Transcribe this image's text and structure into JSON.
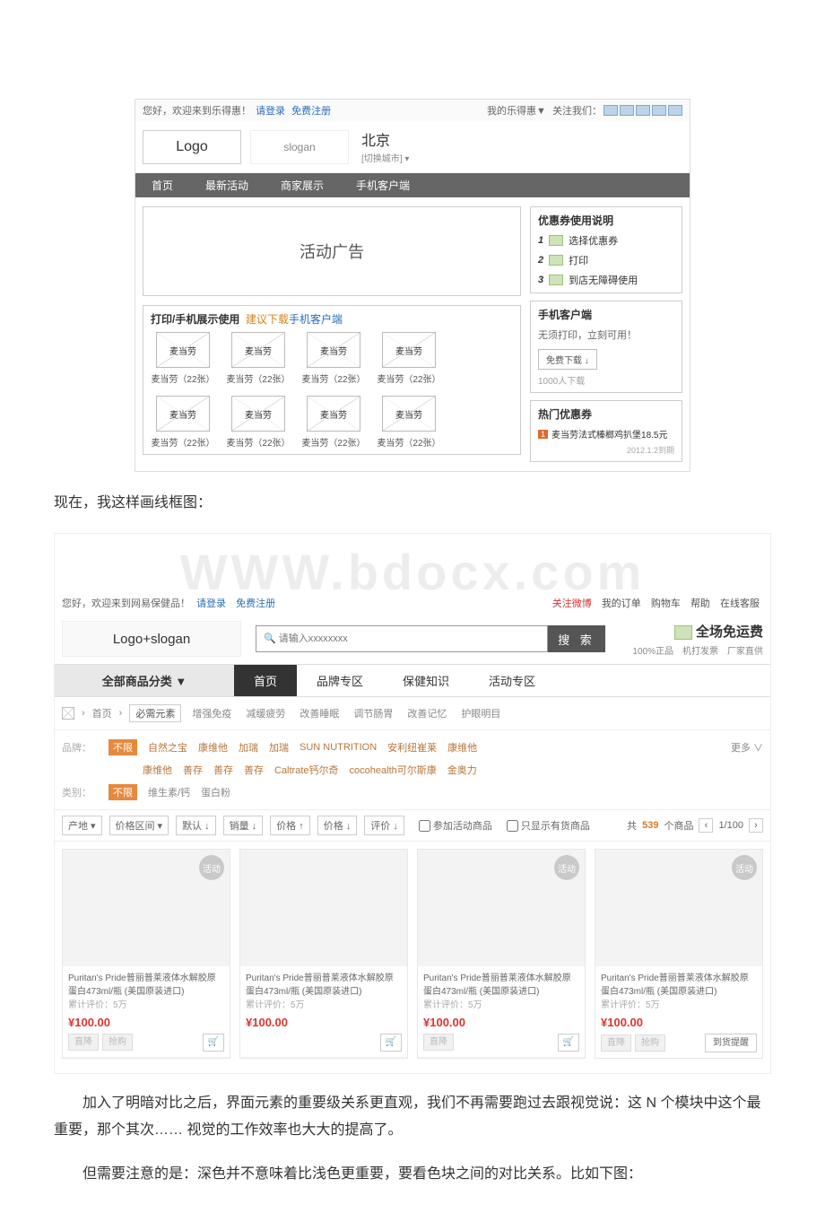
{
  "wf1": {
    "top_greet": "您好，欢迎来到乐得惠！",
    "login": "请登录",
    "register": "免费注册",
    "my": "我的乐得惠▼",
    "follow": "关注我们：",
    "logo": "Logo",
    "slogan": "slogan",
    "city": "北京",
    "city_sub": "[切换城市] ▾",
    "nav": [
      "首页",
      "最新活动",
      "商家展示",
      "手机客户端"
    ],
    "hero": "活动广告",
    "section_title": "打印/手机展示使用",
    "section_tip": "建议下载",
    "section_link": "手机客户端",
    "item_name": "麦当劳",
    "item_count": "麦当劳（22张）",
    "side_inst_title": "优惠券使用说明",
    "steps": [
      "选择优惠券",
      "打印",
      "到店无障碍使用"
    ],
    "side_mob_title": "手机客户端",
    "side_mob_txt": "无须打印，立刻可用！",
    "side_mob_btn": "免费下载 ↓",
    "side_mob_sub": "1000人下载",
    "side_hot_title": "热门优惠券",
    "side_hot_item": "麦当劳法式榛榔鸡扒堡18.5元",
    "side_hot_date": "2012.1.2到期"
  },
  "para1": "现在，我这样画线框图：",
  "wf2": {
    "top_greet": "您好，欢迎来到网易保健品！",
    "login": "请登录",
    "register": "免费注册",
    "rt": [
      "关注微博",
      "我的订单",
      "购物车",
      "帮助",
      "在线客服"
    ],
    "logo": "Logo+slogan",
    "search_ph": "🔍 请输入xxxxxxxx",
    "search_btn": "搜 索",
    "promo_big": "全场免运费",
    "promo_sm": "100%正品　机打发票　厂家直供",
    "cat": "全部商品分类 ▼",
    "nav": [
      "首页",
      "品牌专区",
      "保健知识",
      "活动专区"
    ],
    "crumb_root": "首页",
    "crumb_cur": "必需元素",
    "crumb_items": [
      "增强免疫",
      "减缓疲劳",
      "改善睡眠",
      "调节肠胃",
      "改善记忆",
      "护眼明目"
    ],
    "filter_brand_label": "品牌：",
    "filter_all": "不限",
    "brand_r1": [
      "自然之宝",
      "康维他",
      "加瑞",
      "加瑞",
      "SUN NUTRITION",
      "安利纽崔莱",
      "康维他"
    ],
    "brand_r2": [
      "康维他",
      "善存",
      "善存",
      "善存",
      "Caltrate钙尔奇",
      "cocohealth可尔斯康",
      "金奥力"
    ],
    "filter_more": "更多 ∨",
    "filter_cat_label": "类别：",
    "cat_opts": [
      "维生素/钙",
      "蛋白粉"
    ],
    "sort_origin": "产地",
    "sort_price_range": "价格区间",
    "sort_default": "默认 ↓",
    "sort_sales": "销量 ↓",
    "sort_price_up": "价格 ↑",
    "sort_price_dn": "价格 ↓",
    "sort_review": "评价 ↓",
    "cb_promo": "参加活动商品",
    "cb_stock": "只显示有货商品",
    "total_pre": "共",
    "total_num": "539",
    "total_suf": "个商品",
    "page": "1/100",
    "badge": "活动",
    "prod_name": "Puritan's Pride普丽普莱液体水解胶原蛋白473ml/瓶 (美国原装进口)",
    "prod_rev": "累计评价：5万",
    "prod_price": "¥100.00",
    "btn_direct": "直降",
    "btn_buy": "抢购",
    "btn_remind": "到货提醒",
    "cart": "🛒"
  },
  "para2": "加入了明暗对比之后，界面元素的重要级关系更直观，我们不再需要跑过去跟视觉说：这 N 个模块中这个最重要，那个其次…… 视觉的工作效率也大大的提高了。",
  "para3": "但需要注意的是：深色并不意味着比浅色更重要，要看色块之间的对比关系。比如下图："
}
